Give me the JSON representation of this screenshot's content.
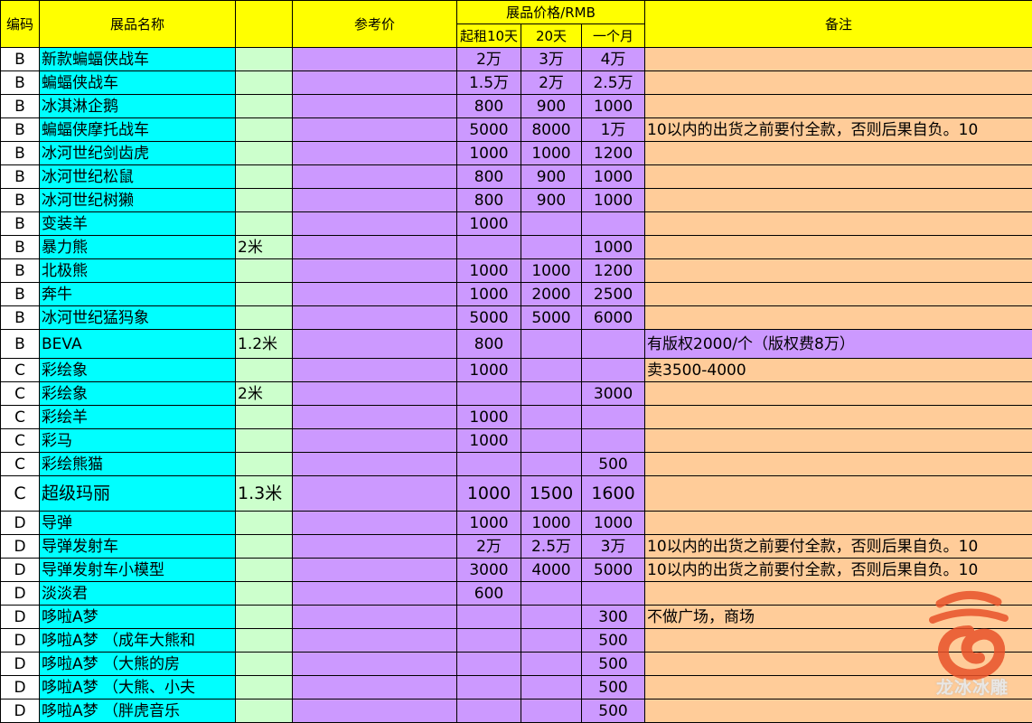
{
  "header": {
    "code": "编码",
    "name": "展品名称",
    "ref_price": "参考价",
    "price_group": "展品价格/RMB",
    "p10": "起租10天",
    "p20": "20天",
    "p30": "一个月",
    "note": "备注"
  },
  "rows": [
    {
      "code": "B",
      "name": "新款蝙蝠侠战车",
      "size": "",
      "p10": "2万",
      "p20": "3万",
      "p30": "4万",
      "note": ""
    },
    {
      "code": "B",
      "name": "蝙蝠侠战车",
      "size": "",
      "p10": "1.5万",
      "p20": "2万",
      "p30": "2.5万",
      "note": ""
    },
    {
      "code": "B",
      "name": "冰淇淋企鹅",
      "size": "",
      "p10": "800",
      "p20": "900",
      "p30": "1000",
      "note": ""
    },
    {
      "code": "B",
      "name": "蝙蝠侠摩托战车",
      "size": "",
      "p10": "5000",
      "p20": "8000",
      "p30": "1万",
      "note": "10以内的出货之前要付全款，否则后果自负。10"
    },
    {
      "code": "B",
      "name": "冰河世纪剑齿虎",
      "size": "",
      "p10": "1000",
      "p20": "1000",
      "p30": "1200",
      "note": ""
    },
    {
      "code": "B",
      "name": "冰河世纪松鼠",
      "size": "",
      "p10": "800",
      "p20": "900",
      "p30": "1000",
      "note": ""
    },
    {
      "code": "B",
      "name": "冰河世纪树獭",
      "size": "",
      "p10": "800",
      "p20": "900",
      "p30": "1000",
      "note": ""
    },
    {
      "code": "B",
      "name": "变装羊",
      "size": "",
      "p10": "1000",
      "p20": "",
      "p30": "",
      "note": ""
    },
    {
      "code": "B",
      "name": "暴力熊",
      "size": "2米",
      "p10": "",
      "p20": "",
      "p30": "1000",
      "note": ""
    },
    {
      "code": "B",
      "name": "北极熊",
      "size": "",
      "p10": "1000",
      "p20": "1000",
      "p30": "1200",
      "note": ""
    },
    {
      "code": "B",
      "name": "奔牛",
      "size": "",
      "p10": "1000",
      "p20": "2000",
      "p30": "2500",
      "note": ""
    },
    {
      "code": "B",
      "name": "冰河世纪猛犸象",
      "size": "",
      "p10": "5000",
      "p20": "5000",
      "p30": "6000",
      "note": ""
    },
    {
      "code": "B",
      "name": "BEVA",
      "size": "1.2米",
      "p10": "800",
      "p20": "",
      "p30": "",
      "note": "有版权2000/个（版权费8万）"
    },
    {
      "code": "C",
      "name": "彩绘象",
      "size": "",
      "p10": "1000",
      "p20": "",
      "p30": "",
      "note": "卖3500-4000"
    },
    {
      "code": "C",
      "name": "彩绘象",
      "size": "2米",
      "p10": "",
      "p20": "",
      "p30": "3000",
      "note": ""
    },
    {
      "code": "C",
      "name": "彩绘羊",
      "size": "",
      "p10": "1000",
      "p20": "",
      "p30": "",
      "note": ""
    },
    {
      "code": "C",
      "name": "彩马",
      "size": "",
      "p10": "1000",
      "p20": "",
      "p30": "",
      "note": ""
    },
    {
      "code": "C",
      "name": "彩绘熊猫",
      "size": "",
      "p10": "",
      "p20": "",
      "p30": "500",
      "note": ""
    },
    {
      "code": "C",
      "name": "超级玛丽",
      "size": "1.3米",
      "p10": "1000",
      "p20": "1500",
      "p30": "1600",
      "note": ""
    },
    {
      "code": "D",
      "name": "导弹",
      "size": "",
      "p10": "1000",
      "p20": "1000",
      "p30": "1000",
      "note": ""
    },
    {
      "code": "D",
      "name": "导弹发射车",
      "size": "",
      "p10": "2万",
      "p20": "2.5万",
      "p30": "3万",
      "note": "10以内的出货之前要付全款，否则后果自负。10"
    },
    {
      "code": "D",
      "name": "导弹发射车小模型",
      "size": "",
      "p10": "3000",
      "p20": "4000",
      "p30": "5000",
      "note": "10以内的出货之前要付全款，否则后果自负。10"
    },
    {
      "code": "D",
      "name": "淡淡君",
      "size": "",
      "p10": "600",
      "p20": "",
      "p30": "",
      "note": ""
    },
    {
      "code": "D",
      "name": "哆啦A梦",
      "size": "",
      "p10": "",
      "p20": "",
      "p30": "300",
      "note": "不做广场，商场"
    },
    {
      "code": "D",
      "name": "哆啦A梦 （成年大熊和",
      "size": "",
      "p10": "",
      "p20": "",
      "p30": "500",
      "note": ""
    },
    {
      "code": "D",
      "name": "哆啦A梦 （大熊的房",
      "size": "",
      "p10": "",
      "p20": "",
      "p30": "500",
      "note": ""
    },
    {
      "code": "D",
      "name": "哆啦A梦 （大熊、小夫",
      "size": "",
      "p10": "",
      "p20": "",
      "p30": "500",
      "note": ""
    },
    {
      "code": "D",
      "name": "哆啦A梦 （胖虎音乐",
      "size": "",
      "p10": "",
      "p20": "",
      "p30": "500",
      "note": ""
    }
  ],
  "watermark": {
    "text": "龙冰冰雕",
    "color": "#e8522a"
  },
  "colors": {
    "header": "#ffff00",
    "name": "#00ffff",
    "size": "#ccffcc",
    "price": "#cc99ff",
    "note": "#ffcc99"
  }
}
